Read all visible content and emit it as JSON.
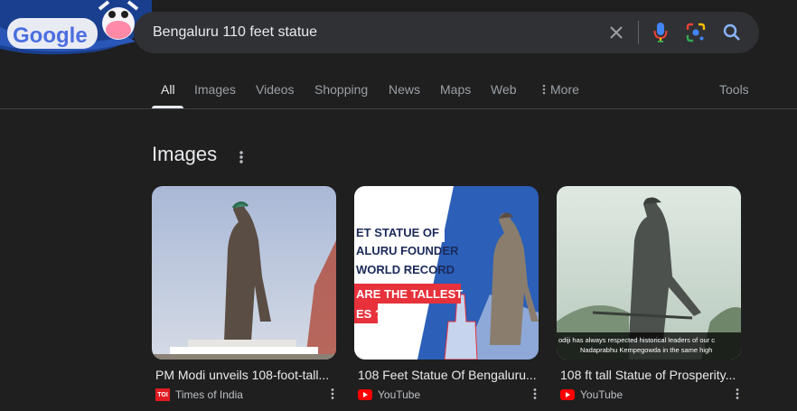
{
  "doodle": {
    "logo_text": "Google"
  },
  "search": {
    "query": "Bengaluru 110 feet statue",
    "clear_icon": "close-icon",
    "voice_icon": "mic-icon",
    "lens_icon": "lens-icon",
    "search_icon": "search-icon"
  },
  "tabs": [
    {
      "label": "All",
      "active": true
    },
    {
      "label": "Images"
    },
    {
      "label": "Videos"
    },
    {
      "label": "Shopping"
    },
    {
      "label": "News"
    },
    {
      "label": "Maps"
    },
    {
      "label": "Web"
    },
    {
      "label": "More"
    }
  ],
  "tools_label": "Tools",
  "images_section": {
    "title": "Images",
    "cards": [
      {
        "title": "PM Modi unveils 108-foot-tall...",
        "source": "Times of India",
        "source_badge": "TOI"
      },
      {
        "title": "108 Feet Statue Of Bengaluru...",
        "source": "YouTube",
        "overlay_lines": [
          "ET STATUE OF",
          "ALURU FOUNDER",
          "WORLD RECORD",
          "ARE THE TALLEST",
          "ES ?"
        ]
      },
      {
        "title": "108 ft tall Statue of Prosperity...",
        "source": "YouTube",
        "caption_lines": [
          "odiji has always respected historical leaders of our c",
          "Nadaprabhu Kempegowda in the same high"
        ]
      }
    ]
  },
  "colors": {
    "background": "#1f1f1f",
    "search_bg": "#303134",
    "text": "#e8eaed",
    "muted": "#9aa0a6",
    "youtube_red": "#ff0000",
    "toi_red": "#e21b22"
  }
}
